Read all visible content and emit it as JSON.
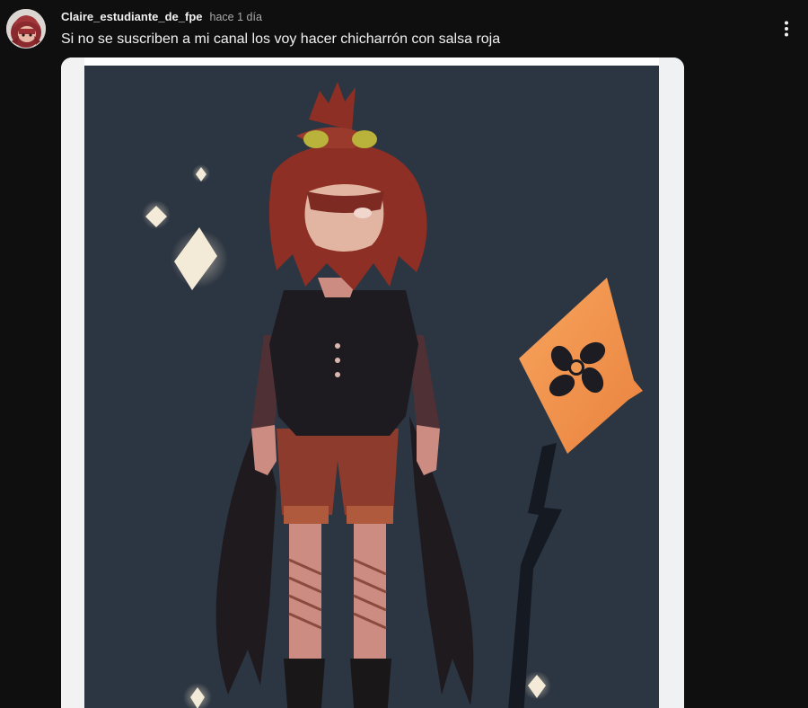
{
  "post": {
    "author": "Claire_estudiante_de_fpe",
    "time": "hace 1 día",
    "text": "Si no se suscriben a mi canal los voy hacer chicharrón con salsa roja"
  },
  "avatar": {
    "icon": "avatar-character"
  },
  "menu": {
    "icon": "more-vert-icon"
  },
  "image": {
    "icon": "character-artwork",
    "background_color": "#2c3542"
  }
}
